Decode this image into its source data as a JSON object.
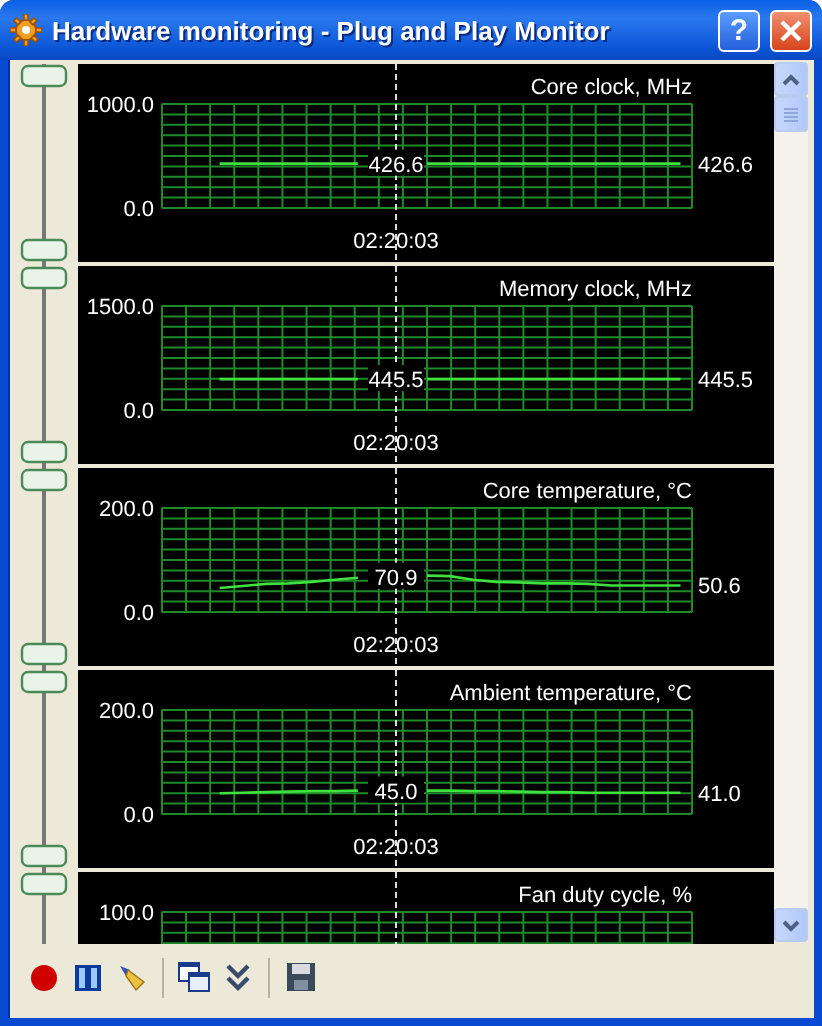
{
  "window": {
    "title": "Hardware monitoring - Plug and Play Monitor",
    "help_button": "?"
  },
  "graphs": [
    {
      "kind": "full",
      "cursor_value": "426.6",
      "current_value": "426.6",
      "cursor_time": "02:20:03",
      "chart_data": {
        "type": "line",
        "title": "Core clock, MHz",
        "grid": true,
        "ylim": [
          0,
          1000
        ],
        "yticks": [
          {
            "value": 0,
            "label": "0.0"
          },
          {
            "value": 1000,
            "label": "1000.0"
          }
        ],
        "series": [
          {
            "color": "#40e040",
            "values": [
              null,
              null,
              426.6,
              426.6,
              426.6,
              426.6,
              426.6,
              426.6,
              426.6,
              null,
              null,
              426.6,
              426.6,
              426.6,
              426.6,
              426.6,
              426.6,
              426.6,
              426.6,
              426.6,
              426.6,
              426.6,
              426.6
            ]
          }
        ]
      }
    },
    {
      "kind": "full",
      "cursor_value": "445.5",
      "current_value": "445.5",
      "cursor_time": "02:20:03",
      "chart_data": {
        "type": "line",
        "title": "Memory clock, MHz",
        "grid": true,
        "ylim": [
          0,
          1500
        ],
        "yticks": [
          {
            "value": 0,
            "label": "0.0"
          },
          {
            "value": 1500,
            "label": "1500.0"
          }
        ],
        "series": [
          {
            "color": "#40e040",
            "values": [
              null,
              null,
              445.5,
              445.5,
              445.5,
              445.5,
              445.5,
              445.5,
              445.5,
              null,
              null,
              445.5,
              445.5,
              445.5,
              445.5,
              445.5,
              445.5,
              445.5,
              445.5,
              445.5,
              445.5,
              445.5,
              445.5
            ]
          }
        ]
      }
    },
    {
      "kind": "full",
      "cursor_value": "70.9",
      "current_value": "50.6",
      "cursor_time": "02:20:03",
      "chart_data": {
        "type": "line",
        "title": "Core temperature, °C",
        "grid": true,
        "ylim": [
          0,
          200
        ],
        "yticks": [
          {
            "value": 0,
            "label": "0.0"
          },
          {
            "value": 200,
            "label": "200.0"
          }
        ],
        "series": [
          {
            "color": "#40e040",
            "values": [
              null,
              null,
              46,
              50,
              54,
              55,
              58,
              62,
              66,
              null,
              null,
              70,
              69,
              62,
              58,
              57,
              55,
              55,
              54,
              51,
              51,
              51,
              51
            ]
          }
        ]
      }
    },
    {
      "kind": "full",
      "cursor_value": "45.0",
      "current_value": "41.0",
      "cursor_time": "02:20:03",
      "chart_data": {
        "type": "line",
        "title": "Ambient temperature, °C",
        "grid": true,
        "ylim": [
          0,
          200
        ],
        "yticks": [
          {
            "value": 0,
            "label": "0.0"
          },
          {
            "value": 200,
            "label": "200.0"
          }
        ],
        "series": [
          {
            "color": "#40e040",
            "values": [
              null,
              null,
              40,
              41,
              42,
              43,
              44,
              44,
              45,
              null,
              null,
              45,
              45,
              44,
              44,
              43,
              42,
              42,
              41,
              41,
              41,
              41,
              41
            ]
          }
        ]
      }
    },
    {
      "kind": "partial",
      "title": "Fan duty cycle, %",
      "top_label": "100.0"
    }
  ]
}
